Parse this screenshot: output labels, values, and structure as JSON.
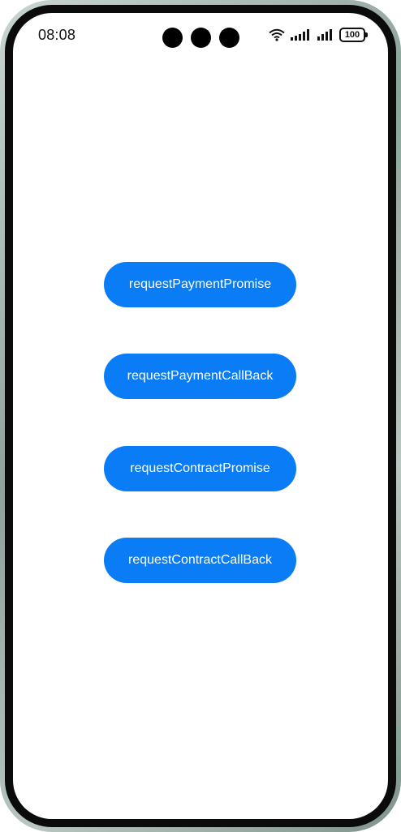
{
  "status_bar": {
    "time": "08:08",
    "battery_level": "100",
    "icons": [
      "wifi-icon",
      "signal-icon",
      "signal-icon",
      "battery-icon"
    ]
  },
  "buttons": [
    {
      "label": "requestPaymentPromise"
    },
    {
      "label": "requestPaymentCallBack"
    },
    {
      "label": "requestContractPromise"
    },
    {
      "label": "requestContractCallBack"
    }
  ],
  "colors": {
    "button_background": "#0a7cf6",
    "button_text": "#ffffff",
    "screen_background": "#ffffff"
  }
}
